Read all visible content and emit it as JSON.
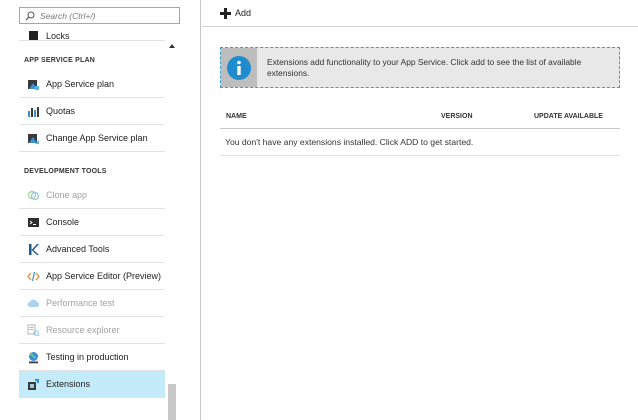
{
  "sidebar": {
    "search_placeholder": "Search (Ctrl+/)",
    "partial_item": {
      "label": "Locks",
      "icon": "lock-icon"
    },
    "sections": [
      {
        "header": "APP SERVICE PLAN",
        "items": [
          {
            "label": "App Service plan",
            "icon": "app-service-plan-icon",
            "state": "normal"
          },
          {
            "label": "Quotas",
            "icon": "quotas-chart-icon",
            "state": "normal"
          },
          {
            "label": "Change App Service plan",
            "icon": "change-plan-icon",
            "state": "normal"
          }
        ]
      },
      {
        "header": "DEVELOPMENT TOOLS",
        "items": [
          {
            "label": "Clone app",
            "icon": "clone-icon",
            "state": "disabled"
          },
          {
            "label": "Console",
            "icon": "console-icon",
            "state": "normal"
          },
          {
            "label": "Advanced Tools",
            "icon": "kudu-icon",
            "state": "normal"
          },
          {
            "label": "App Service Editor (Preview)",
            "icon": "code-editor-icon",
            "state": "normal"
          },
          {
            "label": "Performance test",
            "icon": "cloud-icon",
            "state": "disabled"
          },
          {
            "label": "Resource explorer",
            "icon": "resource-explorer-icon",
            "state": "disabled"
          },
          {
            "label": "Testing in production",
            "icon": "globe-icon",
            "state": "normal"
          },
          {
            "label": "Extensions",
            "icon": "extensions-icon",
            "state": "active"
          }
        ]
      }
    ]
  },
  "toolbar": {
    "add_label": "Add"
  },
  "info": {
    "icon": "info-icon",
    "text": "Extensions add functionality to your App Service. Click add to see the list of available extensions."
  },
  "table": {
    "columns": [
      "NAME",
      "VERSION",
      "UPDATE AVAILABLE"
    ],
    "empty_message": "You don't have any extensions installed. Click ADD to get started."
  },
  "colors": {
    "active_bg": "#c3ebf9",
    "info_border": "#35a2cc",
    "info_icon": "#1e8ccf"
  }
}
